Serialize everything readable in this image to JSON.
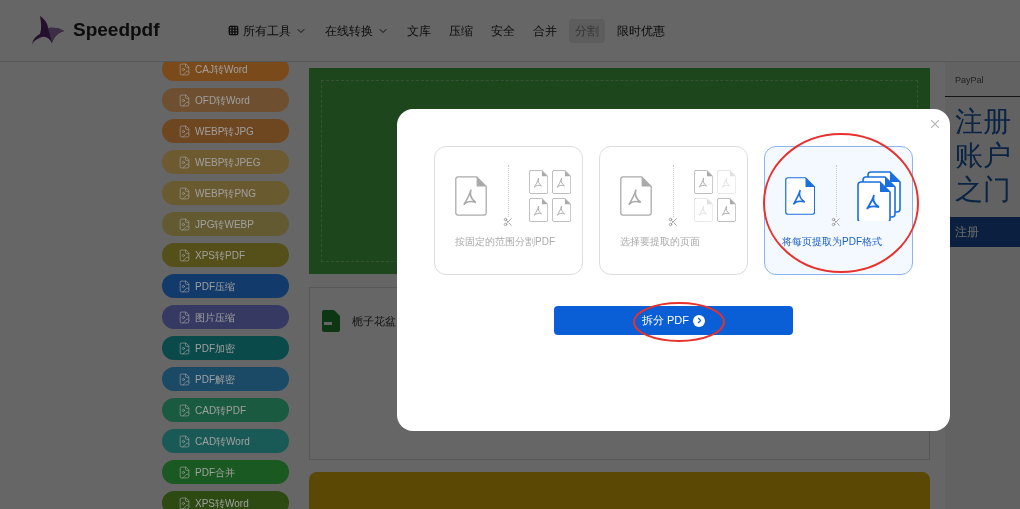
{
  "header": {
    "logo": "Speedpdf",
    "nav": [
      {
        "label": "所有工具",
        "kind": "grid-menu",
        "selected": false
      },
      {
        "label": "在线转换",
        "kind": "menu",
        "selected": false
      },
      {
        "label": "文库",
        "kind": "link",
        "selected": false
      },
      {
        "label": "压缩",
        "kind": "link",
        "selected": false
      },
      {
        "label": "安全",
        "kind": "link",
        "selected": false
      },
      {
        "label": "合并",
        "kind": "link",
        "selected": false
      },
      {
        "label": "分割",
        "kind": "link",
        "selected": true
      },
      {
        "label": "限时优惠",
        "kind": "link",
        "selected": false
      }
    ]
  },
  "sidebar": {
    "items": [
      {
        "label": "CAJ转Word",
        "color": "#7a4a1a"
      },
      {
        "label": "OFD转Word",
        "color": "#6e5030"
      },
      {
        "label": "WEBP转JPG",
        "color": "#6e4620"
      },
      {
        "label": "WEBP转JPEG",
        "color": "#6e5a30"
      },
      {
        "label": "WEBP转PNG",
        "color": "#6a5a30"
      },
      {
        "label": "JPG转WEBP",
        "color": "#645a32"
      },
      {
        "label": "XPS转PDF",
        "color": "#55501a"
      },
      {
        "label": "PDF压缩",
        "color": "#123a6a"
      },
      {
        "label": "图片压缩",
        "color": "#363a62"
      },
      {
        "label": "PDF加密",
        "color": "#0a4a4a"
      },
      {
        "label": "PDF解密",
        "color": "#1a4a66"
      },
      {
        "label": "CAD转PDF",
        "color": "#1a5a40"
      },
      {
        "label": "CAD转Word",
        "color": "#1a5a56"
      },
      {
        "label": "PDF合并",
        "color": "#1a5a22"
      },
      {
        "label": "XPS转Word",
        "color": "#2c4a12"
      }
    ]
  },
  "file": {
    "name": "栀子花盆"
  },
  "ad": {
    "brand": "PayPal",
    "headline": [
      "注册",
      "账户",
      "之门"
    ],
    "button": "注册"
  },
  "dialog": {
    "options": [
      {
        "kind": "range",
        "label": "按固定的范围分割PDF",
        "selected": false
      },
      {
        "kind": "extract",
        "label": "选择要提取的页面",
        "selected": false
      },
      {
        "kind": "each",
        "label": "将每页提取为PDF格式",
        "selected": true
      }
    ],
    "button": "拆分 PDF"
  }
}
